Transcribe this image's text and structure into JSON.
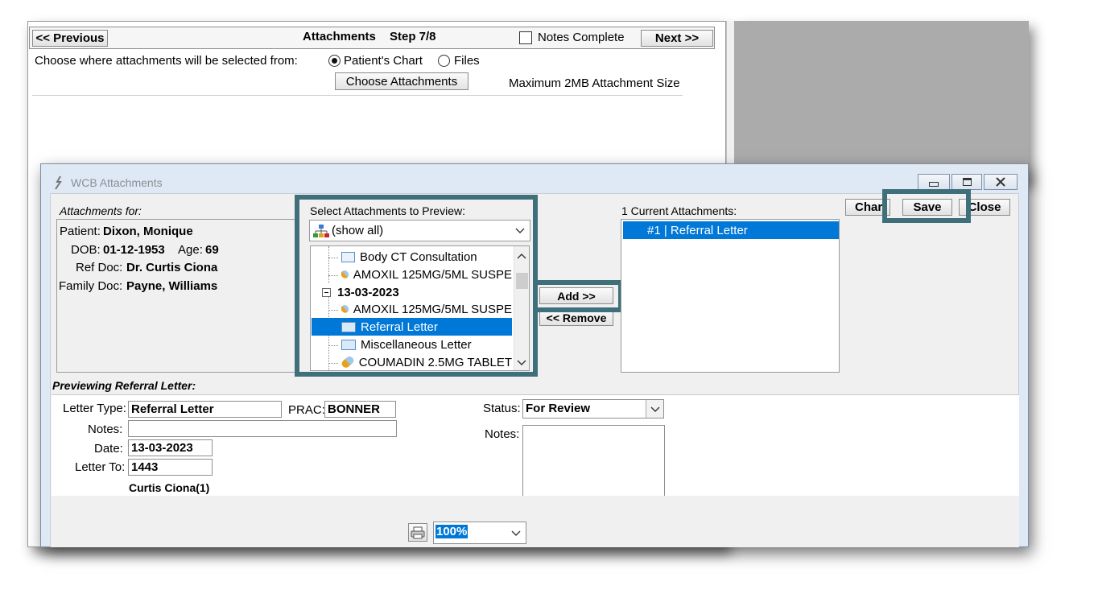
{
  "wizard": {
    "previous_label": "<< Previous",
    "title": "Attachments",
    "step": "Step 7/8",
    "notes_complete_label": "Notes Complete",
    "next_label": "Next >>",
    "choose_where_label": "Choose where attachments will be selected from:",
    "source_options": [
      "Patient's Chart",
      "Files"
    ],
    "selected_source": "Patient's Chart",
    "choose_attachments_label": "Choose Attachments",
    "max_size_text": "Maximum 2MB Attachment Size"
  },
  "dialog": {
    "title": "WCB Attachments",
    "attachments_for_label": "Attachments for:",
    "patient": {
      "patient_label": "Patient:",
      "patient_name": "Dixon, Monique",
      "dob_label": "DOB:",
      "dob": "01-12-1953",
      "age_label": "Age:",
      "age": "69",
      "ref_doc_label": "Ref Doc:",
      "ref_doc": "Dr. Curtis Ciona",
      "family_doc_label": "Family Doc:",
      "family_doc": "Payne, Williams"
    },
    "select_label": "Select Attachments to Preview:",
    "filter_value": "(show all)",
    "tree": [
      {
        "label": "Body CT Consultation",
        "icon": "document-icon"
      },
      {
        "label": "AMOXIL 125MG/5ML SUSPE",
        "icon": "pill-icon"
      },
      {
        "label": "13-03-2023",
        "icon": "collapse-icon"
      },
      {
        "label": "AMOXIL 125MG/5ML SUSPE",
        "icon": "pill-icon"
      },
      {
        "label": "Referral Letter",
        "icon": "envelope-icon",
        "selected": true
      },
      {
        "label": "Miscellaneous Letter",
        "icon": "envelope-icon"
      },
      {
        "label": "COUMADIN 2.5MG TABLET",
        "icon": "pill-icon"
      }
    ],
    "add_label": "Add >>",
    "remove_label": "<< Remove",
    "current_label": "1 Current Attachments:",
    "current_items": [
      "#1 | Referral Letter"
    ],
    "chart_label": "Char",
    "save_label": "Save",
    "close_label": "Close"
  },
  "preview": {
    "heading": "Previewing Referral Letter:",
    "letter_type_label": "Letter Type:",
    "letter_type": "Referral Letter",
    "prac_label": "PRAC:",
    "prac": "BONNER",
    "notes_label": "Notes:",
    "notes": "",
    "date_label": "Date:",
    "date": "13-03-2023",
    "letter_to_label": "Letter To:",
    "letter_to": "1443",
    "recipient_name": "Curtis Ciona(1)",
    "status_label": "Status:",
    "status": "For Review",
    "notes2_label": "Notes:",
    "zoom": "100%"
  },
  "colors": {
    "highlight_frame": "#3f6f7b",
    "selection": "#0078d7"
  }
}
